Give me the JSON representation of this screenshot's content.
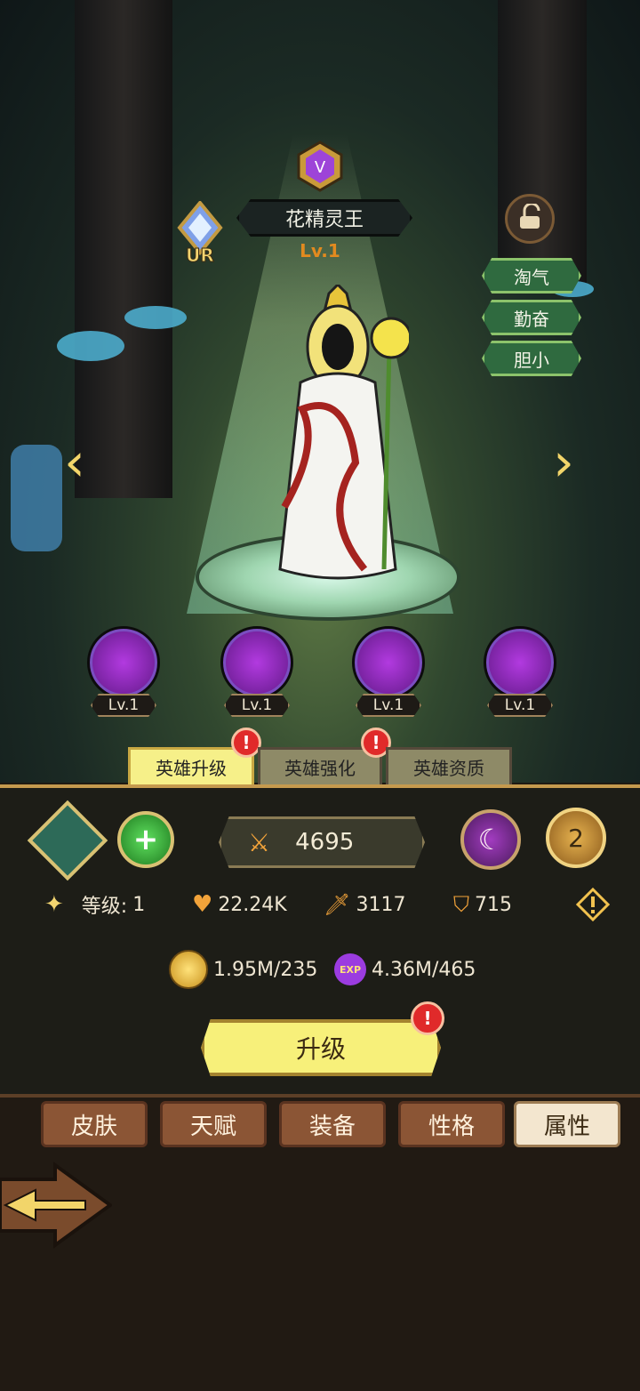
{
  "hero": {
    "name": "花精灵王",
    "level": "Lv.1",
    "rarity": "UR",
    "vip": "V",
    "traits": [
      "淘气",
      "勤奋",
      "胆小"
    ],
    "skills": [
      {
        "icon": "dash-skill-icon",
        "level": "Lv.1"
      },
      {
        "icon": "strike-skill-icon",
        "level": "Lv.1"
      },
      {
        "icon": "skull-skill-icon",
        "level": "Lv.1"
      },
      {
        "icon": "crack-skill-icon",
        "level": "Lv.1"
      }
    ]
  },
  "tabs": [
    {
      "label": "英雄升级",
      "active": true,
      "alert": "!"
    },
    {
      "label": "英雄强化",
      "active": false,
      "alert": "!"
    },
    {
      "label": "英雄资质",
      "active": false
    }
  ],
  "stats": {
    "power": "4695",
    "star_badge": "2",
    "level_label": "等级:",
    "level_value": "1",
    "hp": "22.24K",
    "attack": "3117",
    "defense": "715"
  },
  "cost": {
    "gold": "1.95M/235",
    "exp": "4.36M/465",
    "exp_icon_text": "EXP"
  },
  "upgrade": {
    "label": "升级",
    "alert": "!"
  },
  "bottom_menu": [
    {
      "label": "皮肤",
      "active": false
    },
    {
      "label": "天赋",
      "active": false
    },
    {
      "label": "装备",
      "active": false
    },
    {
      "label": "性格",
      "active": false
    },
    {
      "label": "属性",
      "active": true
    }
  ],
  "colors": {
    "active_tab": "#f6f089",
    "upgrade_button": "#f7f07a",
    "skill_purple": "#b23ae0"
  }
}
